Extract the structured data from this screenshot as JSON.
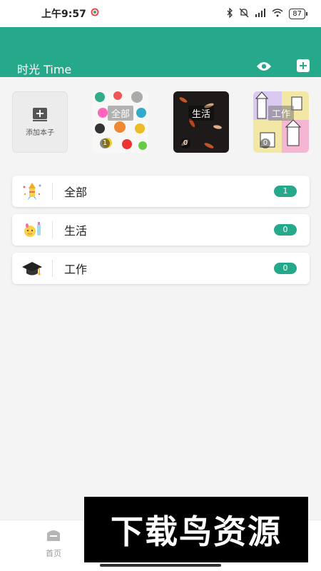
{
  "status_bar": {
    "time": "上午9:57",
    "battery": "87"
  },
  "header": {
    "title": "时光 Time"
  },
  "notebooks": {
    "add_label": "添加本子",
    "items": [
      {
        "label": "全部",
        "count": "1"
      },
      {
        "label": "生活",
        "count": "0"
      },
      {
        "label": "工作",
        "count": "0"
      }
    ]
  },
  "categories": [
    {
      "name": "全部",
      "count": "1",
      "icon": "rocket-icon"
    },
    {
      "name": "生活",
      "count": "0",
      "icon": "baby-icon"
    },
    {
      "name": "工作",
      "count": "0",
      "icon": "graduation-cap-icon"
    }
  ],
  "bottom_nav": {
    "home_label": "首页"
  },
  "watermark": "下载鸟资源",
  "colors": {
    "accent": "#26a98b",
    "background": "#f4f4f4"
  }
}
